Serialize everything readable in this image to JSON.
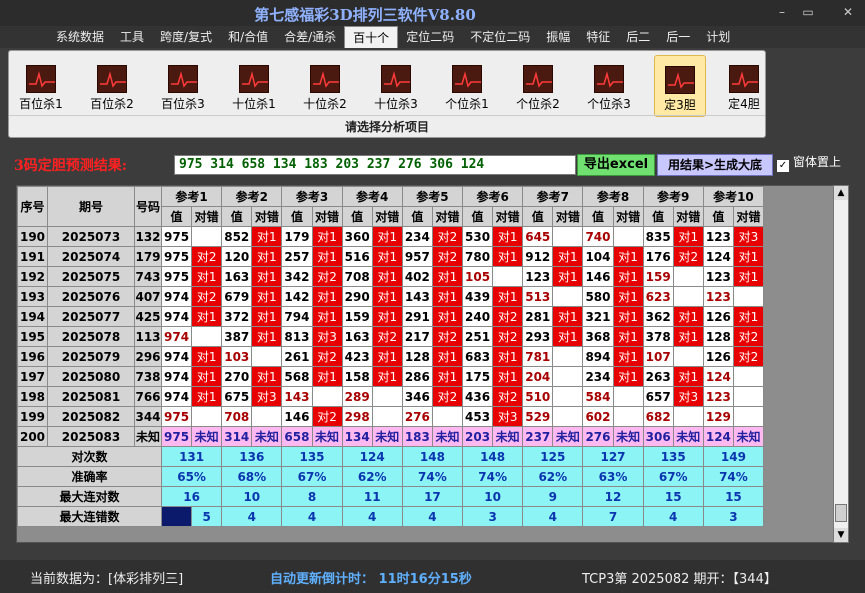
{
  "window": {
    "title": "第七感福彩3D排列三软件V8.80",
    "minimize": "–",
    "restore": "▭",
    "close": "✕"
  },
  "menu": [
    "系统数据",
    "工具",
    "跨度/复式",
    "和/合值",
    "合差/通杀",
    "百十个",
    "定位二码",
    "不定位二码",
    "振幅",
    "特征",
    "后二",
    "后一",
    "计划"
  ],
  "menu_active": 5,
  "ribbon": {
    "items": [
      "百位杀1",
      "百位杀2",
      "百位杀3",
      "十位杀1",
      "十位杀2",
      "十位杀3",
      "个位杀1",
      "个位杀2",
      "个位杀3",
      "定3胆",
      "定4胆"
    ],
    "selected": 9,
    "caption": "请选择分析项目",
    "icon": "line-chart-icon"
  },
  "prediction": {
    "label": "3码定胆预测结果:",
    "value": "975 314 658 134 183 203 237 276 306 124",
    "export_label": "导出excel",
    "generate_label": "用结果>生成大底",
    "topmost_label": "窗体置上",
    "topmost_checked": "✓"
  },
  "table": {
    "left_headers": [
      "序号",
      "期号",
      "号码"
    ],
    "ref_headers": [
      "参考1",
      "参考2",
      "参考3",
      "参考4",
      "参考5",
      "参考6",
      "参考7",
      "参考8",
      "参考9",
      "参考10"
    ],
    "sub_value": "值",
    "sub_hit": "对错",
    "rows": [
      {
        "seq": "190",
        "issue": "2025073",
        "num": "132",
        "cells": [
          [
            "975",
            "w",
            ""
          ],
          [
            "852",
            "w",
            "对1"
          ],
          [
            "179",
            "w",
            "对1"
          ],
          [
            "360",
            "w",
            "对1"
          ],
          [
            "234",
            "w",
            "对2"
          ],
          [
            "530",
            "w",
            "对1"
          ],
          [
            "645",
            "r",
            ""
          ],
          [
            "740",
            "r",
            ""
          ],
          [
            "835",
            "w",
            "对1"
          ],
          [
            "123",
            "w",
            "对3"
          ]
        ]
      },
      {
        "seq": "191",
        "issue": "2025074",
        "num": "179",
        "cells": [
          [
            "975",
            "w",
            "对2"
          ],
          [
            "120",
            "w",
            "对1"
          ],
          [
            "257",
            "w",
            "对1"
          ],
          [
            "516",
            "w",
            "对1"
          ],
          [
            "957",
            "w",
            "对2"
          ],
          [
            "780",
            "w",
            "对1"
          ],
          [
            "912",
            "w",
            "对1"
          ],
          [
            "104",
            "w",
            "对1"
          ],
          [
            "176",
            "w",
            "对2"
          ],
          [
            "124",
            "w",
            "对1"
          ]
        ]
      },
      {
        "seq": "192",
        "issue": "2025075",
        "num": "743",
        "cells": [
          [
            "975",
            "w",
            "对1"
          ],
          [
            "163",
            "w",
            "对1"
          ],
          [
            "342",
            "w",
            "对2"
          ],
          [
            "708",
            "w",
            "对1"
          ],
          [
            "402",
            "w",
            "对1"
          ],
          [
            "105",
            "r",
            ""
          ],
          [
            "123",
            "w",
            "对1"
          ],
          [
            "146",
            "w",
            "对1"
          ],
          [
            "159",
            "r",
            ""
          ],
          [
            "123",
            "w",
            "对1"
          ]
        ]
      },
      {
        "seq": "193",
        "issue": "2025076",
        "num": "407",
        "cells": [
          [
            "974",
            "w",
            "对2"
          ],
          [
            "679",
            "w",
            "对1"
          ],
          [
            "142",
            "w",
            "对1"
          ],
          [
            "290",
            "w",
            "对1"
          ],
          [
            "143",
            "w",
            "对1"
          ],
          [
            "439",
            "w",
            "对1"
          ],
          [
            "513",
            "r",
            ""
          ],
          [
            "580",
            "w",
            "对1"
          ],
          [
            "623",
            "r",
            ""
          ],
          [
            "123",
            "r",
            ""
          ]
        ]
      },
      {
        "seq": "194",
        "issue": "2025077",
        "num": "425",
        "cells": [
          [
            "974",
            "w",
            "对1"
          ],
          [
            "372",
            "w",
            "对1"
          ],
          [
            "794",
            "w",
            "对1"
          ],
          [
            "159",
            "w",
            "对1"
          ],
          [
            "291",
            "w",
            "对1"
          ],
          [
            "240",
            "w",
            "对2"
          ],
          [
            "281",
            "w",
            "对1"
          ],
          [
            "321",
            "w",
            "对1"
          ],
          [
            "362",
            "w",
            "对1"
          ],
          [
            "126",
            "w",
            "对1"
          ]
        ]
      },
      {
        "seq": "195",
        "issue": "2025078",
        "num": "113",
        "cells": [
          [
            "974",
            "r",
            ""
          ],
          [
            "387",
            "w",
            "对1"
          ],
          [
            "813",
            "w",
            "对3"
          ],
          [
            "163",
            "w",
            "对2"
          ],
          [
            "217",
            "w",
            "对2"
          ],
          [
            "251",
            "w",
            "对2"
          ],
          [
            "293",
            "w",
            "对1"
          ],
          [
            "368",
            "w",
            "对1"
          ],
          [
            "378",
            "w",
            "对1"
          ],
          [
            "128",
            "w",
            "对2"
          ]
        ]
      },
      {
        "seq": "196",
        "issue": "2025079",
        "num": "296",
        "cells": [
          [
            "974",
            "w",
            "对1"
          ],
          [
            "103",
            "r",
            ""
          ],
          [
            "261",
            "w",
            "对2"
          ],
          [
            "423",
            "w",
            "对1"
          ],
          [
            "128",
            "w",
            "对1"
          ],
          [
            "683",
            "w",
            "对1"
          ],
          [
            "781",
            "r",
            ""
          ],
          [
            "894",
            "w",
            "对1"
          ],
          [
            "107",
            "r",
            ""
          ],
          [
            "126",
            "w",
            "对2"
          ]
        ]
      },
      {
        "seq": "197",
        "issue": "2025080",
        "num": "738",
        "cells": [
          [
            "974",
            "w",
            "对1"
          ],
          [
            "270",
            "w",
            "对1"
          ],
          [
            "568",
            "w",
            "对1"
          ],
          [
            "158",
            "w",
            "对1"
          ],
          [
            "286",
            "w",
            "对1"
          ],
          [
            "175",
            "w",
            "对1"
          ],
          [
            "204",
            "r",
            ""
          ],
          [
            "234",
            "w",
            "对1"
          ],
          [
            "263",
            "w",
            "对1"
          ],
          [
            "124",
            "r",
            ""
          ]
        ]
      },
      {
        "seq": "198",
        "issue": "2025081",
        "num": "766",
        "cells": [
          [
            "974",
            "w",
            "对1"
          ],
          [
            "675",
            "w",
            "对3"
          ],
          [
            "143",
            "r",
            ""
          ],
          [
            "289",
            "r",
            ""
          ],
          [
            "346",
            "w",
            "对2"
          ],
          [
            "436",
            "w",
            "对2"
          ],
          [
            "510",
            "r",
            ""
          ],
          [
            "584",
            "r",
            ""
          ],
          [
            "657",
            "w",
            "对3"
          ],
          [
            "123",
            "r",
            ""
          ]
        ]
      },
      {
        "seq": "199",
        "issue": "2025082",
        "num": "344",
        "cells": [
          [
            "975",
            "r",
            ""
          ],
          [
            "708",
            "r",
            ""
          ],
          [
            "146",
            "w",
            "对2"
          ],
          [
            "298",
            "r",
            ""
          ],
          [
            "276",
            "r",
            ""
          ],
          [
            "453",
            "w",
            "对3"
          ],
          [
            "529",
            "r",
            ""
          ],
          [
            "602",
            "r",
            ""
          ],
          [
            "682",
            "r",
            ""
          ],
          [
            "129",
            "r",
            ""
          ]
        ]
      }
    ],
    "next_row": {
      "seq": "200",
      "issue": "2025083",
      "num": "未知",
      "values": [
        "975",
        "314",
        "658",
        "134",
        "183",
        "203",
        "237",
        "276",
        "306",
        "124"
      ],
      "hit": "未知"
    },
    "stats": [
      {
        "label": "对次数",
        "values": [
          "131",
          "136",
          "135",
          "124",
          "148",
          "148",
          "125",
          "127",
          "135",
          "149"
        ]
      },
      {
        "label": "准确率",
        "values": [
          "65%",
          "68%",
          "67%",
          "62%",
          "74%",
          "74%",
          "62%",
          "63%",
          "67%",
          "74%"
        ]
      },
      {
        "label": "最大连对数",
        "values": [
          "16",
          "10",
          "8",
          "11",
          "17",
          "10",
          "9",
          "12",
          "15",
          "15"
        ]
      },
      {
        "label": "最大连错数",
        "values": [
          "5",
          "4",
          "4",
          "4",
          "4",
          "3",
          "4",
          "7",
          "4",
          "3"
        ]
      }
    ]
  },
  "status": {
    "source": "当前数据为：[体彩排列三]",
    "countdown": "自动更新倒计时：  11时16分15秒",
    "issue": "TCP3第  2025082  期开：【344】"
  }
}
